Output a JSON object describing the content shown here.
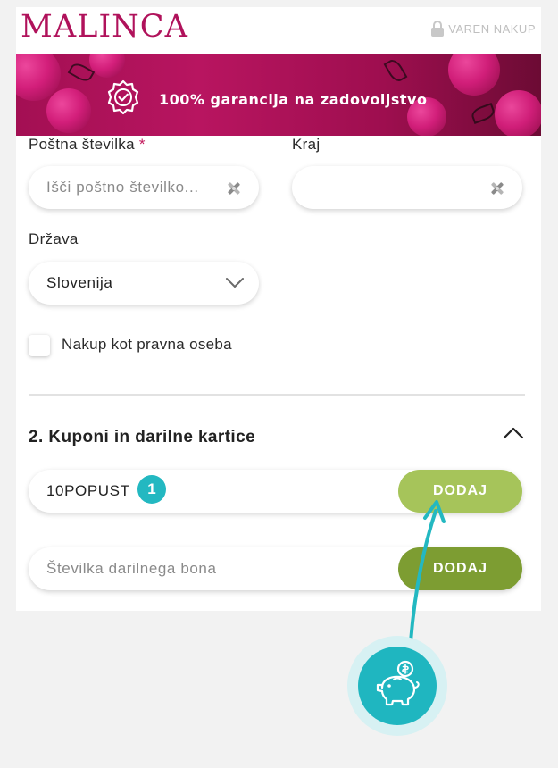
{
  "header": {
    "logo": "MALINCA",
    "secure_label": "VAREN NAKUP",
    "secure_icon": "lock-icon"
  },
  "banner": {
    "text": "100% garancija na zadovoljstvo",
    "icon": "verified-badge-icon"
  },
  "address": {
    "postal_label": "Poštna številka",
    "postal_required_mark": "*",
    "postal_placeholder": "Išči poštno številko...",
    "city_label": "Kraj",
    "city_value": "",
    "country_label": "Država",
    "country_value": "Slovenija",
    "legal_entity_label": "Nakup kot pravna oseba"
  },
  "coupons": {
    "section_title": "2. Kuponi in darilne kartice",
    "coupon_value": "10POPUST",
    "coupon_button": "DODAJ",
    "gift_placeholder": "Številka darilnega bona",
    "gift_button": "DODAJ",
    "step_badge": "1"
  },
  "colors": {
    "brand": "#b0125b",
    "button_light": "#a6c45a",
    "button_dark": "#7d9d32",
    "accent_teal": "#23b8c1"
  }
}
